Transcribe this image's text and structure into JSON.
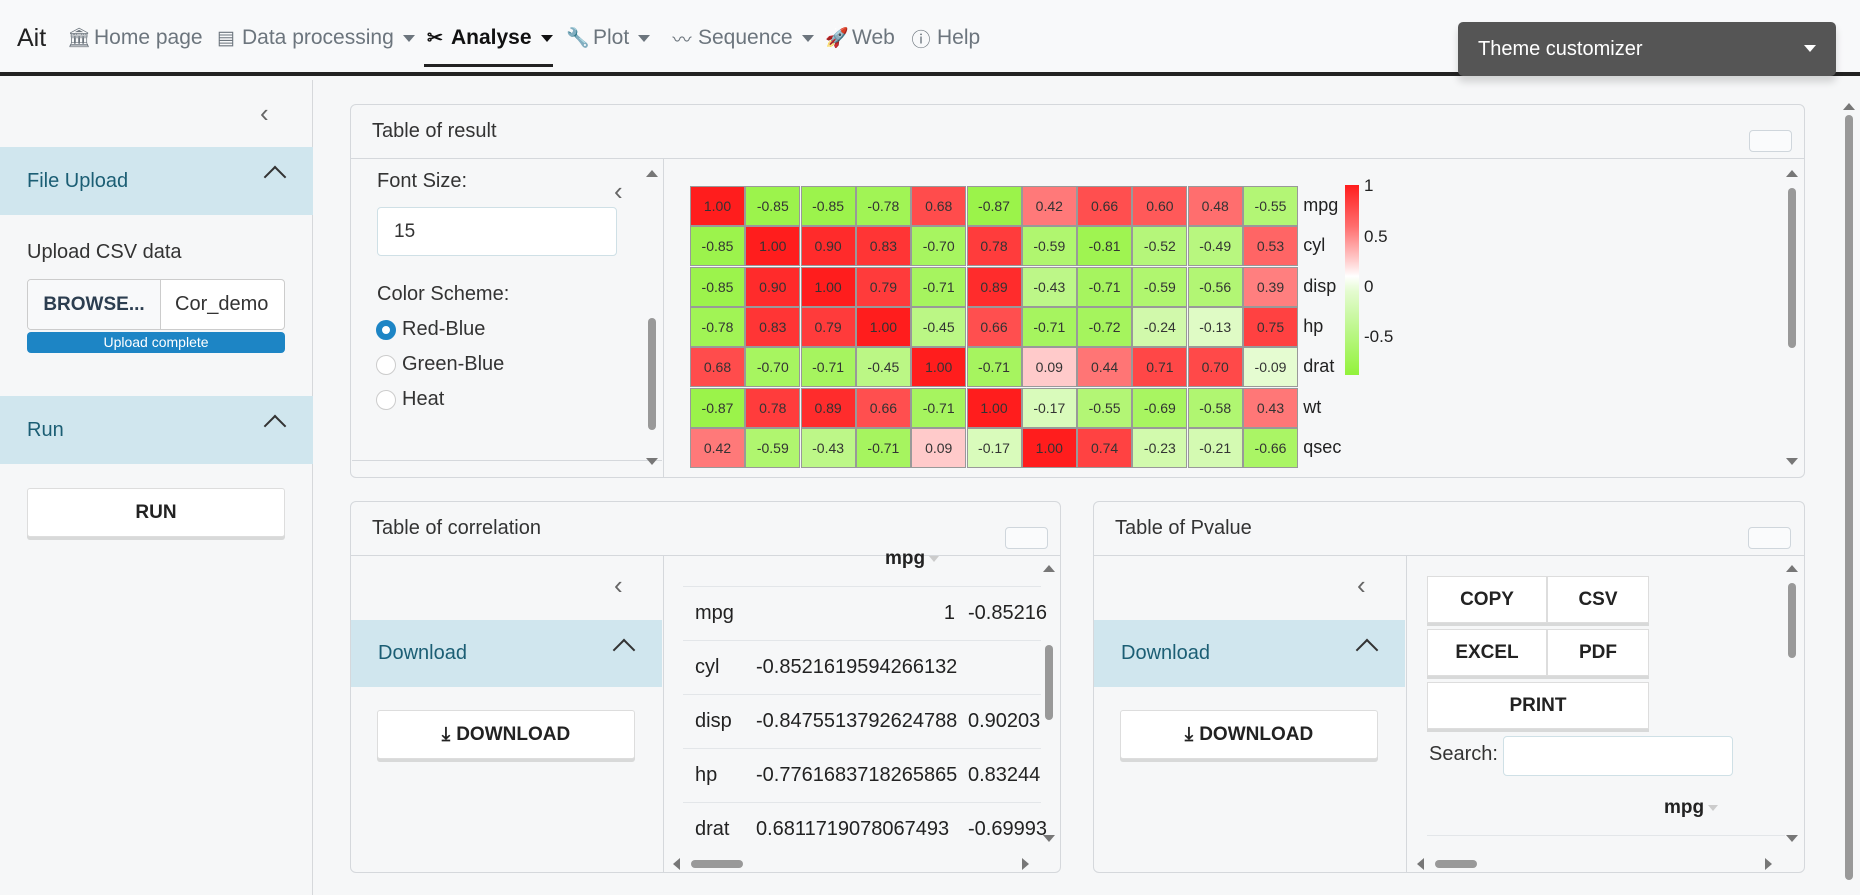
{
  "navbar": {
    "brand": "Ait",
    "items": [
      {
        "label": "Home page"
      },
      {
        "label": "Data processing"
      },
      {
        "label": "Analyse"
      },
      {
        "label": "Plot"
      },
      {
        "label": "Sequence"
      },
      {
        "label": "Web"
      },
      {
        "label": "Help"
      }
    ],
    "theme_button": "Theme customizer"
  },
  "sidebar": {
    "file_upload": {
      "title": "File Upload",
      "label": "Upload CSV data",
      "browse": "BROWSE...",
      "file_name": "Cor_demo",
      "status": "Upload complete"
    },
    "run": {
      "title": "Run",
      "button": "RUN"
    }
  },
  "result_card": {
    "title": "Table of result",
    "options": {
      "font_size_label": "Font Size:",
      "font_size_value": "15",
      "color_scheme_label": "Color Scheme:",
      "schemes": [
        "Red-Blue",
        "Green-Blue",
        "Heat"
      ],
      "selected_scheme": "Red-Blue"
    },
    "heatmap": {
      "row_labels": [
        "mpg",
        "cyl",
        "disp",
        "hp",
        "drat",
        "wt",
        "qsec"
      ],
      "rows": [
        [
          "1.00",
          "-0.85",
          "-0.85",
          "-0.78",
          "0.68",
          "-0.87",
          "0.42",
          "0.66",
          "0.60",
          "0.48",
          "-0.55"
        ],
        [
          "-0.85",
          "1.00",
          "0.90",
          "0.83",
          "-0.70",
          "0.78",
          "-0.59",
          "-0.81",
          "-0.52",
          "-0.49",
          "0.53"
        ],
        [
          "-0.85",
          "0.90",
          "1.00",
          "0.79",
          "-0.71",
          "0.89",
          "-0.43",
          "-0.71",
          "-0.59",
          "-0.56",
          "0.39"
        ],
        [
          "-0.78",
          "0.83",
          "0.79",
          "1.00",
          "-0.45",
          "0.66",
          "-0.71",
          "-0.72",
          "-0.24",
          "-0.13",
          "0.75"
        ],
        [
          "0.68",
          "-0.70",
          "-0.71",
          "-0.45",
          "1.00",
          "-0.71",
          "0.09",
          "0.44",
          "0.71",
          "0.70",
          "-0.09"
        ],
        [
          "-0.87",
          "0.78",
          "0.89",
          "0.66",
          "-0.71",
          "1.00",
          "-0.17",
          "-0.55",
          "-0.69",
          "-0.58",
          "0.43"
        ],
        [
          "0.42",
          "-0.59",
          "-0.43",
          "-0.71",
          "0.09",
          "-0.17",
          "1.00",
          "0.74",
          "-0.23",
          "-0.21",
          "-0.66"
        ]
      ],
      "legend": [
        "1",
        "0.5",
        "0",
        "-0.5"
      ],
      "colors": {
        "positive": "#ff1d1d",
        "neutral": "#ffffff",
        "negative": "#92f23a"
      }
    }
  },
  "correlation_card": {
    "title": "Table of correlation",
    "download_title": "Download",
    "download_button": "DOWNLOAD",
    "header": "mpg",
    "rows": [
      {
        "name": "mpg",
        "c1": "1",
        "c2": "-0.85216"
      },
      {
        "name": "cyl",
        "c1": "-0.8521619594266132",
        "c2": ""
      },
      {
        "name": "disp",
        "c1": "-0.8475513792624788",
        "c2": "0.90203"
      },
      {
        "name": "hp",
        "c1": "-0.7761683718265865",
        "c2": "0.83244"
      },
      {
        "name": "drat",
        "c1": "0.6811719078067493",
        "c2": "-0.69993"
      }
    ]
  },
  "pvalue_card": {
    "title": "Table of Pvalue",
    "download_title": "Download",
    "download_button": "DOWNLOAD",
    "buttons": [
      "COPY",
      "CSV",
      "EXCEL",
      "PDF",
      "PRINT"
    ],
    "search_label": "Search:",
    "search_value": "",
    "header": "mpg"
  }
}
